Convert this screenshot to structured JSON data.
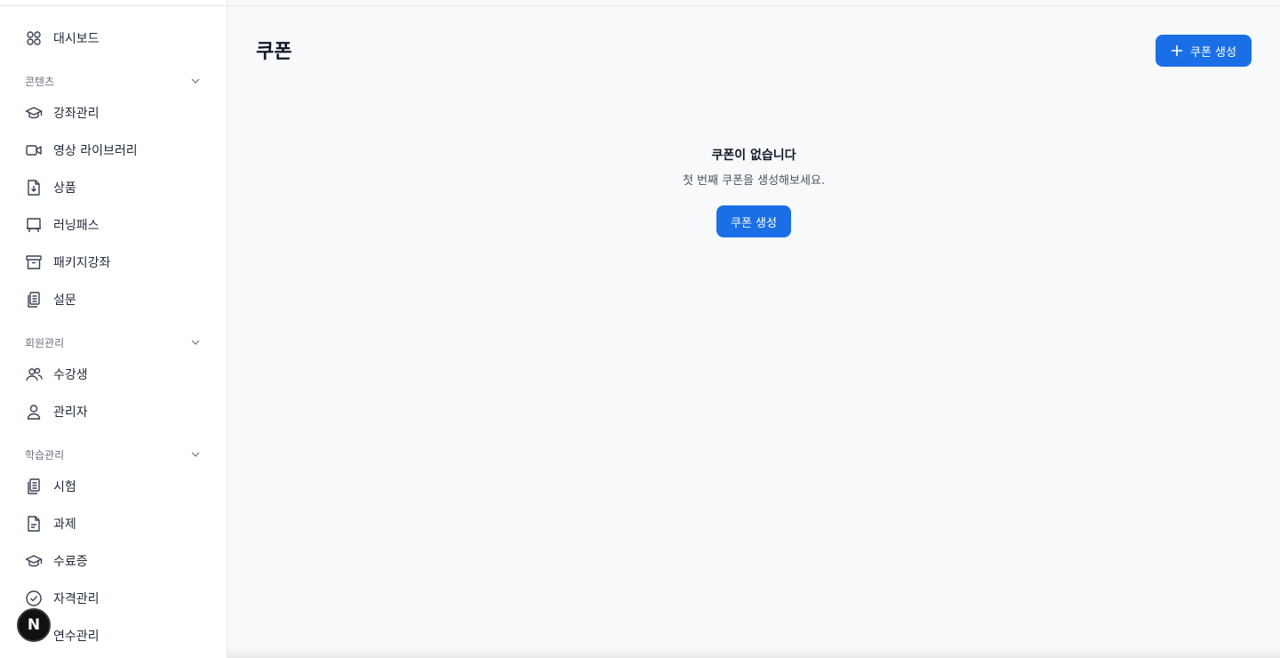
{
  "sidebar": {
    "items": [
      {
        "label": "대시보드",
        "icon": "dashboard-grid-icon"
      },
      {
        "label": "강좌관리",
        "icon": "graduation-cap-icon"
      },
      {
        "label": "영상 라이브러리",
        "icon": "video-camera-icon"
      },
      {
        "label": "상품",
        "icon": "file-download-icon"
      },
      {
        "label": "러닝패스",
        "icon": "presentation-board-icon"
      },
      {
        "label": "패키지강좌",
        "icon": "archive-box-icon"
      },
      {
        "label": "설문",
        "icon": "clipboard-copy-icon"
      },
      {
        "label": "수강생",
        "icon": "users-icon"
      },
      {
        "label": "관리자",
        "icon": "user-icon"
      },
      {
        "label": "시험",
        "icon": "clipboard-copy-icon"
      },
      {
        "label": "과제",
        "icon": "file-text-icon"
      },
      {
        "label": "수료증",
        "icon": "graduation-cap-icon"
      },
      {
        "label": "자격관리",
        "icon": "check-circle-icon"
      },
      {
        "label": "연수관리",
        "icon": "graduation-cap-icon"
      }
    ],
    "sections": [
      {
        "label": "콘텐츠"
      },
      {
        "label": "회원관리"
      },
      {
        "label": "학습관리"
      }
    ]
  },
  "main": {
    "title": "쿠폰",
    "create_button": "쿠폰 생성",
    "empty": {
      "title": "쿠폰이 없습니다",
      "subtitle": "첫 번째 쿠폰을 생성해보세요.",
      "button": "쿠폰 생성"
    }
  },
  "badge": {
    "label": "N"
  },
  "colors": {
    "accent": "#1a6fe6",
    "background": "#f8f9fb",
    "sidebar": "#ffffff"
  }
}
